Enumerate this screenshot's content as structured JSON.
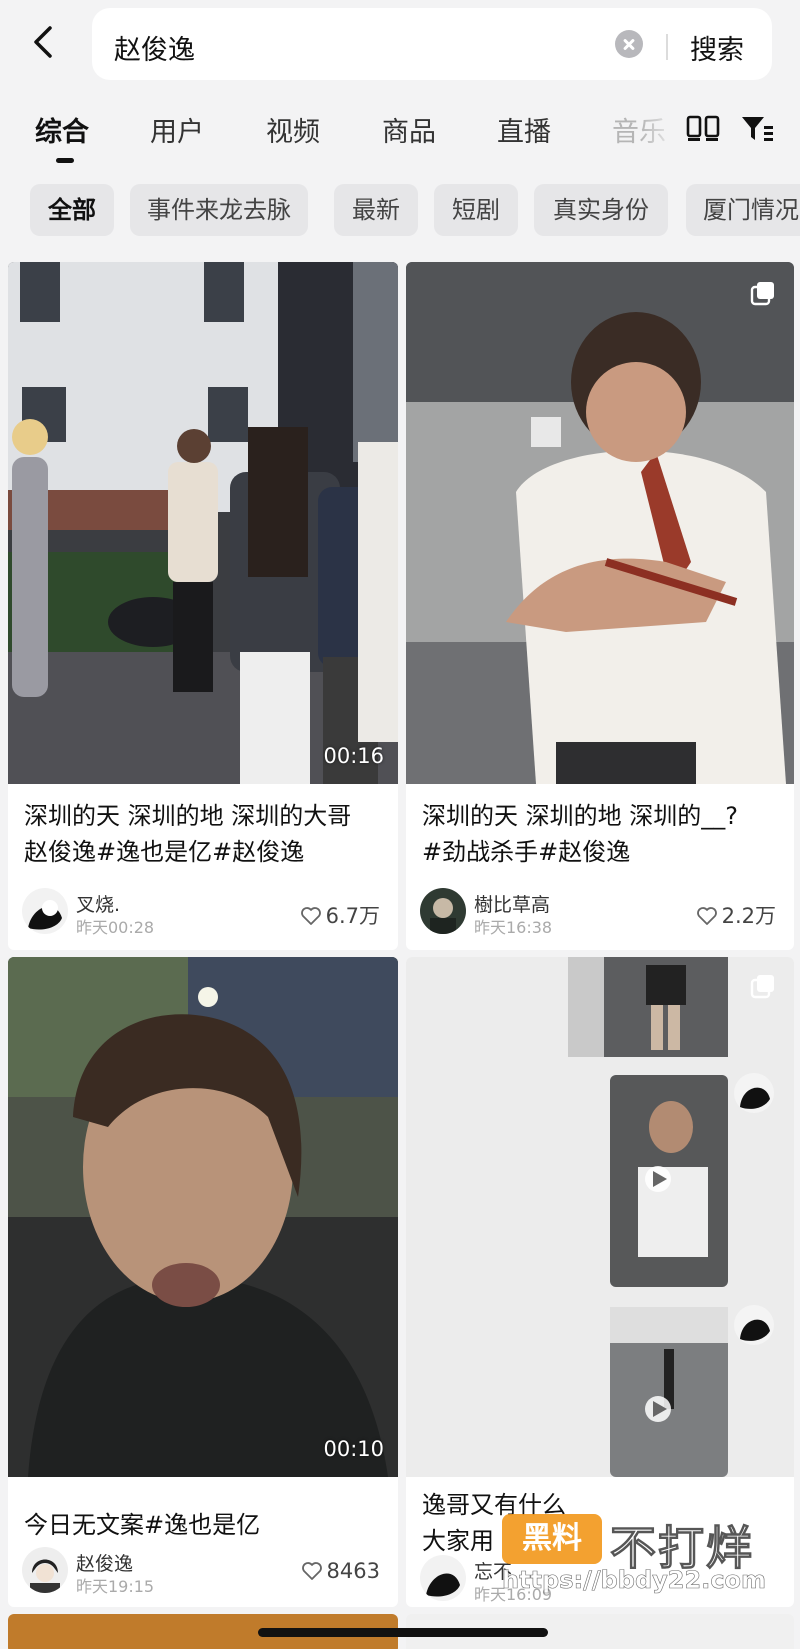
{
  "search": {
    "query": "赵俊逸",
    "button": "搜索"
  },
  "tabs": [
    {
      "label": "综合",
      "active": true
    },
    {
      "label": "用户"
    },
    {
      "label": "视频"
    },
    {
      "label": "商品"
    },
    {
      "label": "直播"
    },
    {
      "label": "音乐"
    }
  ],
  "chips": [
    "全部",
    "事件来龙去脉",
    "最新",
    "短剧",
    "真实身份",
    "厦门情况"
  ],
  "cards": [
    {
      "duration": "00:16",
      "title_line1": "深圳的天 深圳的地 深圳的大哥",
      "title_line2": "赵俊逸#逸也是亿#赵俊逸",
      "author": "叉烧.",
      "time": "昨天00:28",
      "likes": "6.7万"
    },
    {
      "title_line1": "深圳的天 深圳的地 深圳的__?",
      "title_line2": "#劲战杀手#赵俊逸",
      "author": "樹比草高",
      "time": "昨天16:38",
      "likes": "2.2万"
    },
    {
      "duration": "00:10",
      "title_line1": "今日无文案#逸也是亿",
      "author": "赵俊逸",
      "time": "昨天19:15",
      "likes": "8463"
    },
    {
      "title_line1": "逸哥又有什么",
      "title_line2": "大家用",
      "author": "忘不",
      "time": "昨天16:09"
    }
  ],
  "watermark": {
    "box": "黑料",
    "text": "不打烊",
    "url": "https://bbdy22.com"
  },
  "colors": {
    "background": "#f3f3f4",
    "card": "#ffffff",
    "chip": "#e6e6e8",
    "watermark": "#f29a1f"
  }
}
